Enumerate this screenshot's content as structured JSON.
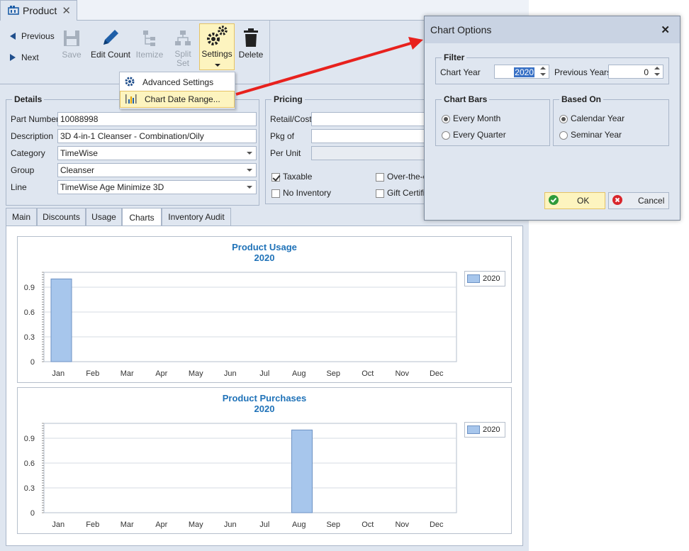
{
  "document_tab": {
    "title": "Product"
  },
  "ribbon": {
    "previous": "Previous",
    "next": "Next",
    "save": "Save",
    "edit_count": "Edit Count",
    "itemize": "Itemize",
    "split_set_line1": "Split",
    "split_set_line2": "Set",
    "settings": "Settings",
    "delete": "Delete"
  },
  "settings_menu": {
    "items": [
      {
        "label": "Advanced Settings",
        "icon": "gear-icon"
      },
      {
        "label": "Chart Date Range...",
        "icon": "chart-range-icon"
      }
    ]
  },
  "details": {
    "title": "Details",
    "part_number_label": "Part Number",
    "part_number": "10088998",
    "description_label": "Description",
    "description": "3D 4-in-1 Cleanser - Combination/Oily",
    "category_label": "Category",
    "category": "TimeWise",
    "group_label": "Group",
    "group": "Cleanser",
    "line_label": "Line",
    "line": "TimeWise Age Minimize 3D"
  },
  "pricing": {
    "title": "Pricing",
    "retail_cost_label": "Retail/Cost",
    "pkg_of_label": "Pkg of",
    "per_unit_label": "Per Unit",
    "taxable_label": "Taxable",
    "taxable_checked": true,
    "no_inventory_label": "No Inventory",
    "no_inventory_checked": false,
    "otc_label": "Over-the-c",
    "gift_label": "Gift Certific"
  },
  "tabs": [
    "Main",
    "Discounts",
    "Usage",
    "Charts",
    "Inventory Audit"
  ],
  "active_tab": "Charts",
  "chart_data": [
    {
      "type": "bar",
      "title": "Product Usage",
      "subtitle": "2020",
      "categories": [
        "Jan",
        "Feb",
        "Mar",
        "Apr",
        "May",
        "Jun",
        "Jul",
        "Aug",
        "Sep",
        "Oct",
        "Nov",
        "Dec"
      ],
      "series": [
        {
          "name": "2020",
          "values": [
            1,
            0,
            0,
            0,
            0,
            0,
            0,
            0,
            0,
            0,
            0,
            0
          ]
        }
      ],
      "yticks": [
        "0",
        "0.3",
        "0.6",
        "0.9"
      ],
      "ylim": [
        0,
        1.08
      ],
      "legend": "top-right",
      "color": "#a7c6ec"
    },
    {
      "type": "bar",
      "title": "Product Purchases",
      "subtitle": "2020",
      "categories": [
        "Jan",
        "Feb",
        "Mar",
        "Apr",
        "May",
        "Jun",
        "Jul",
        "Aug",
        "Sep",
        "Oct",
        "Nov",
        "Dec"
      ],
      "series": [
        {
          "name": "2020",
          "values": [
            0,
            0,
            0,
            0,
            0,
            0,
            0,
            1,
            0,
            0,
            0,
            0
          ]
        }
      ],
      "yticks": [
        "0",
        "0.3",
        "0.6",
        "0.9"
      ],
      "ylim": [
        0,
        1.08
      ],
      "legend": "top-right",
      "color": "#a7c6ec"
    }
  ],
  "dialog": {
    "title": "Chart Options",
    "filter_title": "Filter",
    "chart_year_label": "Chart Year",
    "chart_year": "2020",
    "previous_years_label": "Previous Years",
    "previous_years": "0",
    "chart_bars_title": "Chart Bars",
    "every_month": "Every Month",
    "every_quarter": "Every Quarter",
    "chart_bars_selected": "Every Month",
    "based_on_title": "Based On",
    "calendar_year": "Calendar Year",
    "seminar_year": "Seminar Year",
    "based_on_selected": "Calendar Year",
    "ok": "OK",
    "cancel": "Cancel"
  },
  "colors": {
    "accent": "#1f72b8",
    "highlight": "#fdf4bf",
    "arrow": "#e8211d"
  }
}
